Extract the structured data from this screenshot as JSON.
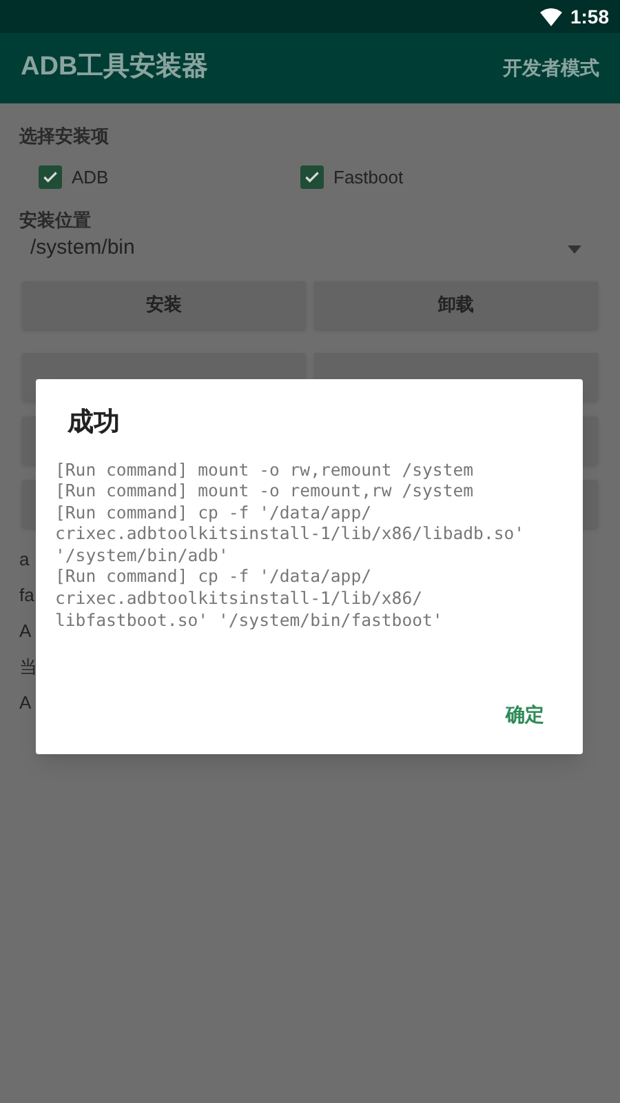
{
  "status_bar": {
    "time": "1:58"
  },
  "app_bar": {
    "title": "ADB工具安装器",
    "action": "开发者模式"
  },
  "install_items": {
    "label": "选择安装项",
    "options": [
      {
        "label": "ADB",
        "checked": true
      },
      {
        "label": "Fastboot",
        "checked": true
      }
    ]
  },
  "install_location": {
    "label": "安装位置",
    "value": "/system/bin"
  },
  "buttons": [
    [
      "安装",
      "卸载"
    ]
  ],
  "info_lines": [
    "a",
    "fa",
    "A",
    "当",
    "A"
  ],
  "dialog": {
    "title": "成功",
    "log": [
      "[Run command] mount -o rw,remount /system",
      "[Run command] mount -o remount,rw /system",
      "[Run command] cp -f '/data/app/",
      "crixec.adbtoolkitsinstall-1/lib/x86/libadb.so'",
      "'/system/bin/adb'",
      "[Run command] cp -f '/data/app/",
      "crixec.adbtoolkitsinstall-1/lib/x86/",
      "libfastboot.so' '/system/bin/fastboot'"
    ],
    "confirm": "确定"
  }
}
